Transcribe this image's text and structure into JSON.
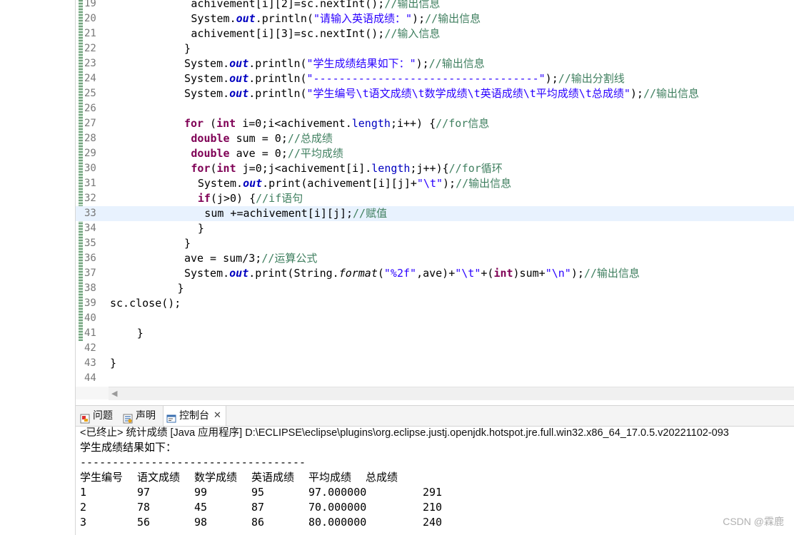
{
  "editor": {
    "lines": [
      {
        "num": "19",
        "indent": 12,
        "parts": [
          [
            "p",
            "achivement[i][2]=sc.nextInt();"
          ],
          [
            "cm",
            "//输出信息"
          ]
        ]
      },
      {
        "num": "20",
        "indent": 12,
        "parts": [
          [
            "p",
            "System."
          ],
          [
            "fl",
            "out"
          ],
          [
            "p",
            ".println("
          ],
          [
            "st",
            "\"请输入英语成绩：\""
          ],
          [
            "p",
            ");"
          ],
          [
            "cm",
            "//输出信息"
          ]
        ]
      },
      {
        "num": "21",
        "indent": 12,
        "parts": [
          [
            "p",
            "achivement[i][3]=sc.nextInt();"
          ],
          [
            "cm",
            "//输入信息"
          ]
        ]
      },
      {
        "num": "22",
        "indent": 11,
        "parts": [
          [
            "p",
            "}"
          ]
        ]
      },
      {
        "num": "23",
        "indent": 11,
        "parts": [
          [
            "p",
            "System."
          ],
          [
            "fl",
            "out"
          ],
          [
            "p",
            ".println("
          ],
          [
            "st",
            "\"学生成绩结果如下：\""
          ],
          [
            "p",
            ");"
          ],
          [
            "cm",
            "//输出信息"
          ]
        ]
      },
      {
        "num": "24",
        "indent": 11,
        "parts": [
          [
            "p",
            "System."
          ],
          [
            "fl",
            "out"
          ],
          [
            "p",
            ".println("
          ],
          [
            "st",
            "\"-----------------------------------\""
          ],
          [
            "p",
            ");"
          ],
          [
            "cm",
            "//输出分割线"
          ]
        ]
      },
      {
        "num": "25",
        "indent": 11,
        "parts": [
          [
            "p",
            "System."
          ],
          [
            "fl",
            "out"
          ],
          [
            "p",
            ".println("
          ],
          [
            "st",
            "\"学生编号\\t语文成绩\\t数学成绩\\t英语成绩\\t平均成绩\\t总成绩\""
          ],
          [
            "p",
            ");"
          ],
          [
            "cm",
            "//输出信息"
          ]
        ]
      },
      {
        "num": "26",
        "indent": 0,
        "parts": []
      },
      {
        "num": "27",
        "indent": 11,
        "parts": [
          [
            "kw",
            "for"
          ],
          [
            "p",
            " ("
          ],
          [
            "kw",
            "int"
          ],
          [
            "p",
            " i=0;i<achivement."
          ],
          [
            "fd",
            "length"
          ],
          [
            "p",
            ";i++) {"
          ],
          [
            "cm",
            "//for信息"
          ]
        ]
      },
      {
        "num": "28",
        "indent": 12,
        "parts": [
          [
            "kw",
            "double"
          ],
          [
            "p",
            " sum = 0;"
          ],
          [
            "cm",
            "//总成绩"
          ]
        ]
      },
      {
        "num": "29",
        "indent": 12,
        "parts": [
          [
            "kw",
            "double"
          ],
          [
            "p",
            " ave = 0;"
          ],
          [
            "cm",
            "//平均成绩"
          ]
        ]
      },
      {
        "num": "30",
        "indent": 12,
        "parts": [
          [
            "kw",
            "for"
          ],
          [
            "p",
            "("
          ],
          [
            "kw",
            "int"
          ],
          [
            "p",
            " j=0;j<achivement[i]."
          ],
          [
            "fd",
            "length"
          ],
          [
            "p",
            ";j++){"
          ],
          [
            "cm",
            "//for循环"
          ]
        ]
      },
      {
        "num": "31",
        "indent": 13,
        "parts": [
          [
            "p",
            "System."
          ],
          [
            "fl",
            "out"
          ],
          [
            "p",
            ".print(achivement[i][j]+"
          ],
          [
            "st",
            "\"\\t\""
          ],
          [
            "p",
            ");"
          ],
          [
            "cm",
            "//输出信息"
          ]
        ]
      },
      {
        "num": "32",
        "indent": 13,
        "parts": [
          [
            "kw",
            "if"
          ],
          [
            "p",
            "(j>0) {"
          ],
          [
            "cm",
            "//if语句"
          ]
        ]
      },
      {
        "num": "33",
        "indent": 14,
        "parts": [
          [
            "p",
            "sum +=achivement[i][j];"
          ],
          [
            "cm",
            "//赋值"
          ]
        ]
      },
      {
        "num": "34",
        "indent": 13,
        "parts": [
          [
            "p",
            "}"
          ]
        ]
      },
      {
        "num": "35",
        "indent": 11,
        "parts": [
          [
            "p",
            "}"
          ]
        ]
      },
      {
        "num": "36",
        "indent": 11,
        "parts": [
          [
            "p",
            "ave = sum/3;"
          ],
          [
            "cm",
            "//运算公式"
          ]
        ]
      },
      {
        "num": "37",
        "indent": 11,
        "parts": [
          [
            "p",
            "System."
          ],
          [
            "fl",
            "out"
          ],
          [
            "p",
            ".print(String."
          ],
          [
            "it",
            "format"
          ],
          [
            "p",
            "("
          ],
          [
            "st",
            "\"%2f\""
          ],
          [
            "p",
            ",ave)+"
          ],
          [
            "st",
            "\"\\t\""
          ],
          [
            "p",
            "+("
          ],
          [
            "kw",
            "int"
          ],
          [
            "p",
            ")sum+"
          ],
          [
            "st",
            "\"\\n\""
          ],
          [
            "p",
            ");"
          ],
          [
            "cm",
            "//输出信息"
          ]
        ]
      },
      {
        "num": "38",
        "indent": 10,
        "parts": [
          [
            "p",
            "}"
          ]
        ]
      },
      {
        "num": "39",
        "indent": 0,
        "parts": [
          [
            "p",
            "sc.close();"
          ]
        ]
      },
      {
        "num": "40",
        "indent": 0,
        "parts": []
      },
      {
        "num": "41",
        "indent": 4,
        "parts": [
          [
            "p",
            "}"
          ]
        ]
      },
      {
        "num": "42",
        "indent": 0,
        "parts": []
      },
      {
        "num": "43",
        "indent": 0,
        "parts": [
          [
            "p",
            "}"
          ]
        ]
      },
      {
        "num": "44",
        "indent": 0,
        "parts": []
      }
    ],
    "current_line": "33"
  },
  "panel": {
    "tabs": [
      {
        "label": "问题",
        "icon": "problems-icon"
      },
      {
        "label": "声明",
        "icon": "declaration-icon"
      },
      {
        "label": "控制台",
        "icon": "console-icon",
        "active": true
      }
    ],
    "status": "<已终止> 统计成绩 [Java 应用程序] D:\\ECLIPSE\\eclipse\\plugins\\org.eclipse.justj.openjdk.hotspot.jre.full.win32.x86_64_17.0.5.v20221102-093",
    "output_lines": [
      "学生成绩结果如下：",
      "-----------------------------------"
    ],
    "headers": [
      "学生编号",
      "语文成绩",
      "数学成绩",
      "英语成绩",
      "平均成绩",
      "总成绩"
    ],
    "rows": [
      [
        "1",
        "97",
        "99",
        "95",
        "97.000000",
        "291"
      ],
      [
        "2",
        "78",
        "45",
        "87",
        "70.000000",
        "210"
      ],
      [
        "3",
        "56",
        "98",
        "86",
        "80.000000",
        "240"
      ]
    ]
  },
  "watermark": "CSDN @霖鹿"
}
